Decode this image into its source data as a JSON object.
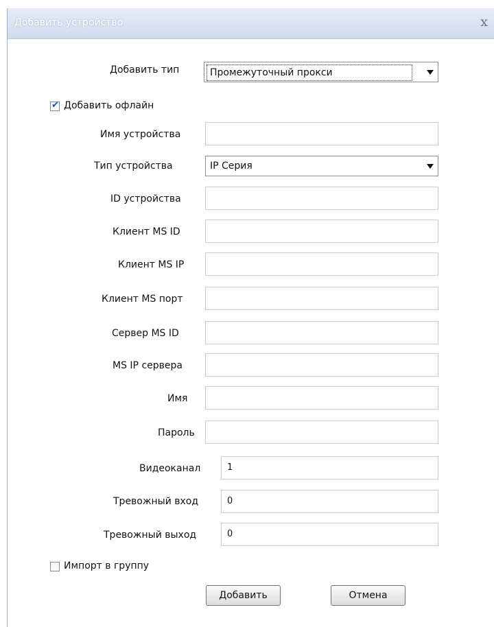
{
  "window": {
    "title": "Добавить устройство",
    "close_symbol": "x"
  },
  "form": {
    "add_type": {
      "label": "Добавить тип",
      "value": "Промежуточный прокси"
    },
    "add_offline": {
      "label": "Добавить офлайн",
      "checked": true
    },
    "device_name": {
      "label": "Имя устройства",
      "value": ""
    },
    "device_type": {
      "label": "Тип устройства",
      "value": "IP Серия"
    },
    "device_id": {
      "label": "ID устройства",
      "value": ""
    },
    "client_ms_id": {
      "label": "Клиент MS ID",
      "value": ""
    },
    "client_ms_ip": {
      "label": "Клиент MS IP",
      "value": ""
    },
    "client_ms_port": {
      "label": "Клиент MS порт",
      "value": ""
    },
    "server_ms_id": {
      "label": "Сервер MS ID",
      "value": ""
    },
    "server_ms_ip": {
      "label": "MS IP сервера",
      "value": ""
    },
    "username": {
      "label": "Имя",
      "value": ""
    },
    "password": {
      "label": "Пароль",
      "value": ""
    },
    "video_channel": {
      "label": "Видеоканал",
      "value": "1"
    },
    "alarm_in": {
      "label": "Тревожный вход",
      "value": "0"
    },
    "alarm_out": {
      "label": "Тревожный выход",
      "value": "0"
    },
    "import_group": {
      "label": "Импорт в группу",
      "checked": false
    }
  },
  "buttons": {
    "add": "Добавить",
    "cancel": "Отмена"
  },
  "icons": {
    "close": "close-icon",
    "dropdown": "chevron-down-icon",
    "check": "checkmark-icon"
  },
  "colors": {
    "titlebar": "#d6e1f0",
    "checkmark": "#2a4d9a",
    "field_border": "#c9ccd1"
  }
}
